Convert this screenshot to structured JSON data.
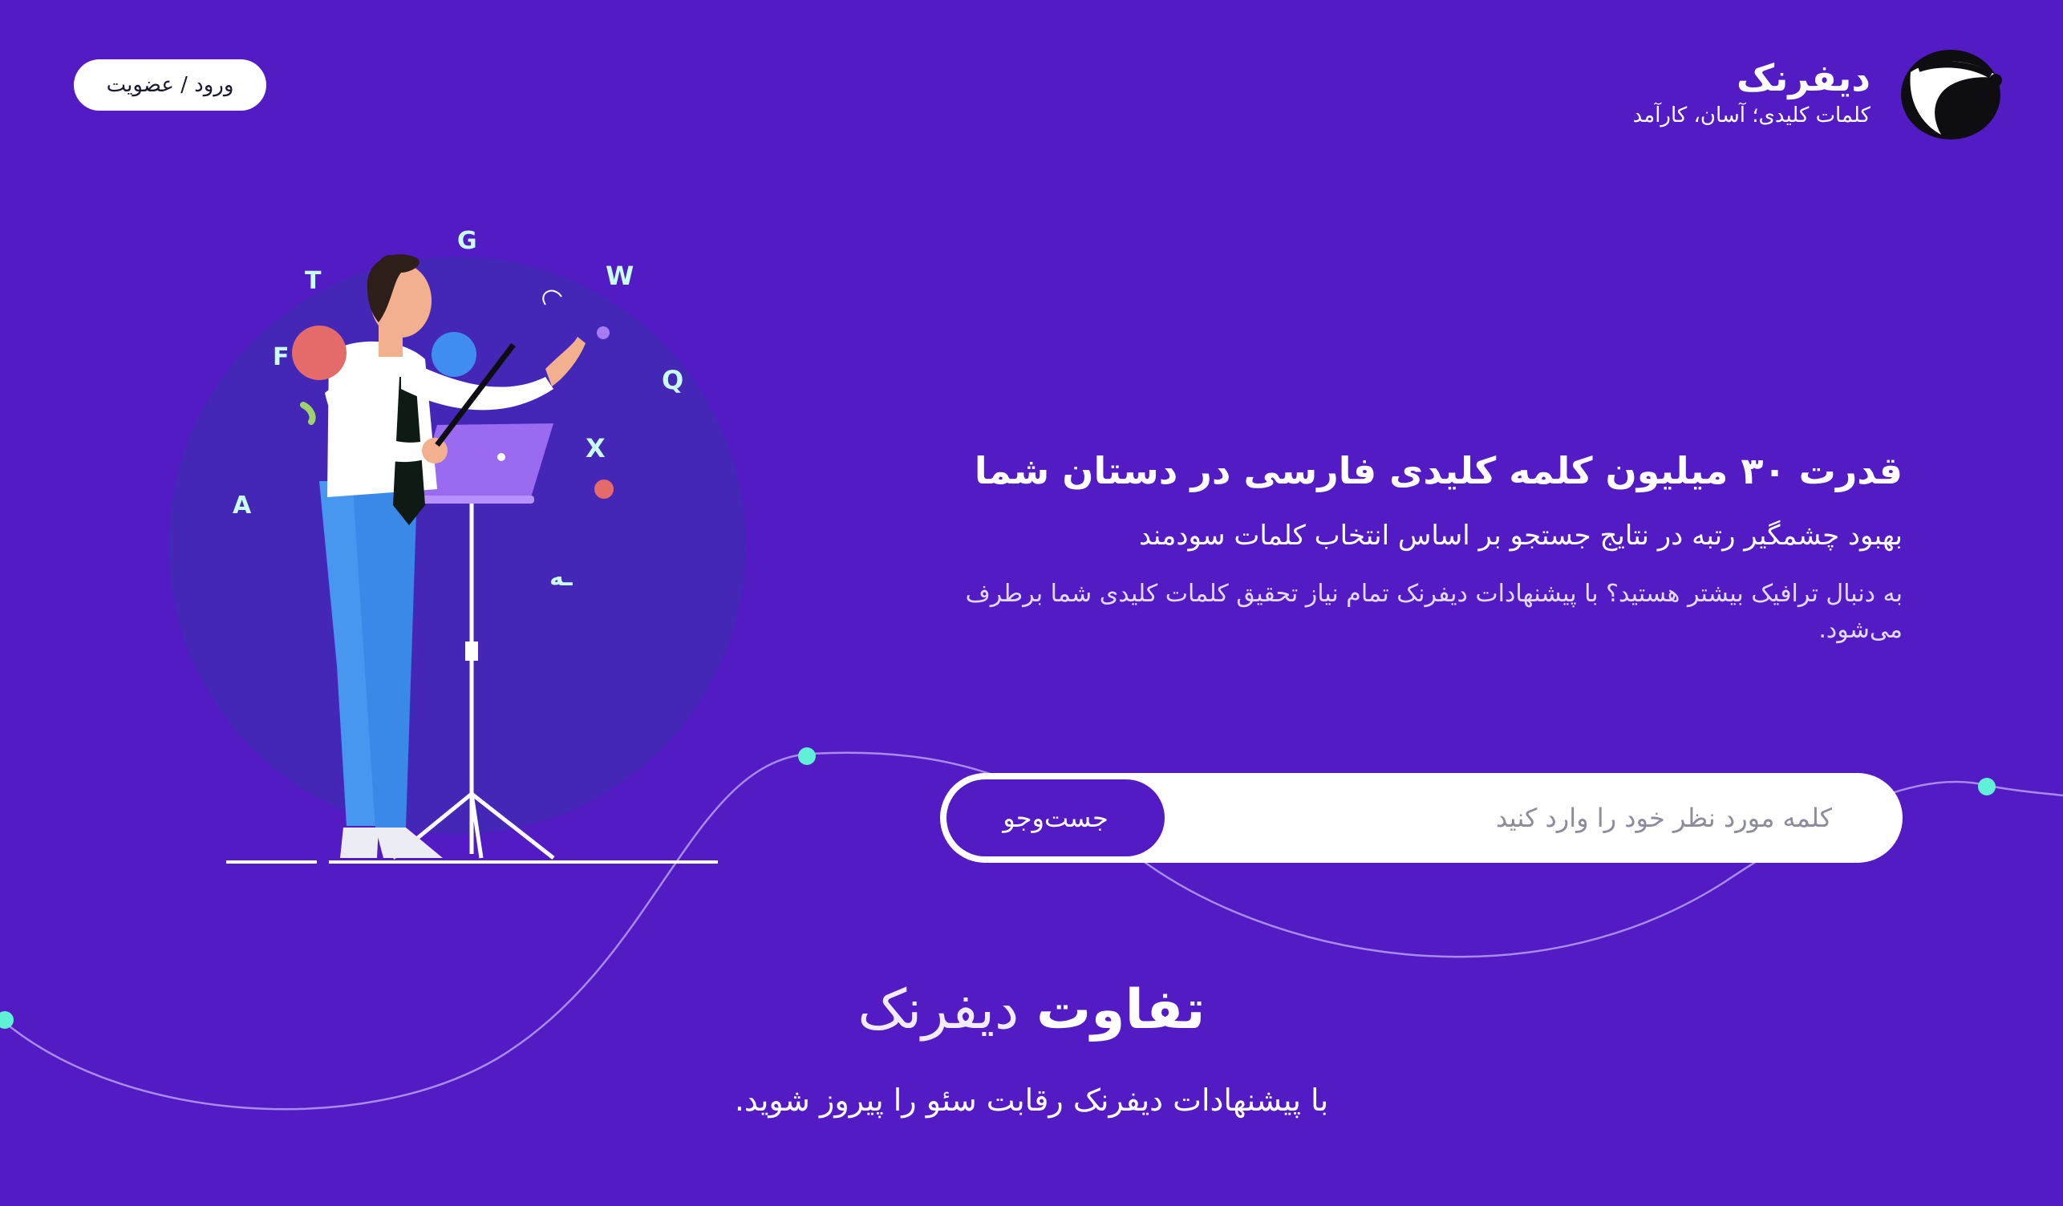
{
  "header": {
    "login_label": "ورود / عضویت",
    "brand_name": "دیفرنک",
    "brand_tagline": "کلمات کلیدی؛ آسان، کارآمد",
    "logo_icon": "badger-logo-icon"
  },
  "hero": {
    "title": "قدرت ۳۰ میلیون کلمه کلیدی فارسی در دستان شما",
    "subtitle": "بهبود چشمگیر رتبه در نتایج جستجو بر اساس انتخاب کلمات سودمند",
    "description": "به دنبال ترافیک بیشتر هستید؟ با پیشنهادات دیفرنک تمام نیاز تحقیق کلمات کلیدی شما برطرف می‌شود."
  },
  "search": {
    "placeholder": "کلمه مورد نظر خود را وارد کنید",
    "value": "",
    "button_label": "جست‌وجو"
  },
  "section": {
    "title_strong": "تفاوت",
    "title_light": "دیفرنک",
    "subtitle": "با پیشنهادات دیفرنک رقابت سئو را پیروز شوید."
  },
  "colors": {
    "background": "#521bc4",
    "accent_dot": "#5ff0d6",
    "button": "#521bc4"
  }
}
